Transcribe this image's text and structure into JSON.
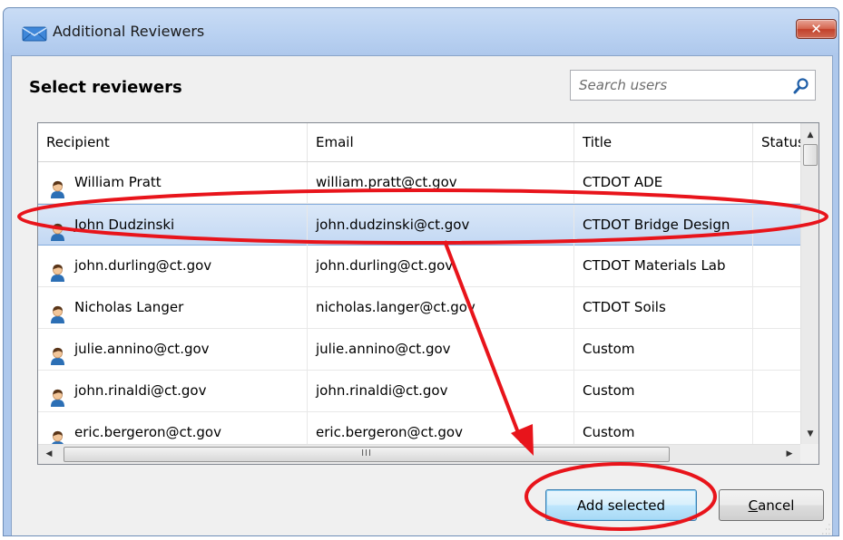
{
  "window": {
    "title": "Additional Reviewers",
    "close_label": "✕",
    "app_icon": "envelope-icon",
    "close_icon": "close-icon"
  },
  "dialog": {
    "heading": "Select reviewers",
    "search": {
      "placeholder": "Search users",
      "value": "",
      "icon": "search-icon"
    }
  },
  "table": {
    "columns": [
      "Recipient",
      "Email",
      "Title",
      "Status"
    ],
    "rows": [
      {
        "recipient": "William Pratt",
        "email": "william.pratt@ct.gov",
        "title": "CTDOT ADE",
        "selected": false
      },
      {
        "recipient": "John Dudzinski",
        "email": "john.dudzinski@ct.gov",
        "title": "CTDOT Bridge Design",
        "selected": true
      },
      {
        "recipient": "john.durling@ct.gov",
        "email": "john.durling@ct.gov",
        "title": "CTDOT Materials Lab",
        "selected": false
      },
      {
        "recipient": "Nicholas Langer",
        "email": "nicholas.langer@ct.gov",
        "title": "CTDOT Soils",
        "selected": false
      },
      {
        "recipient": "julie.annino@ct.gov",
        "email": "julie.annino@ct.gov",
        "title": "Custom",
        "selected": false
      },
      {
        "recipient": "john.rinaldi@ct.gov",
        "email": "john.rinaldi@ct.gov",
        "title": "Custom",
        "selected": false
      },
      {
        "recipient": "eric.bergeron@ct.gov",
        "email": "eric.bergeron@ct.gov",
        "title": "Custom",
        "selected": false
      }
    ],
    "row_icon": "user-icon",
    "hscroll_grip": "III"
  },
  "buttons": {
    "add_selected": "Add selected",
    "cancel_first": "C",
    "cancel_rest": "ancel"
  },
  "colors": {
    "annotation": "#e8141b",
    "selection": "#c3d8f3",
    "title_bar": "#b9d1f1"
  }
}
